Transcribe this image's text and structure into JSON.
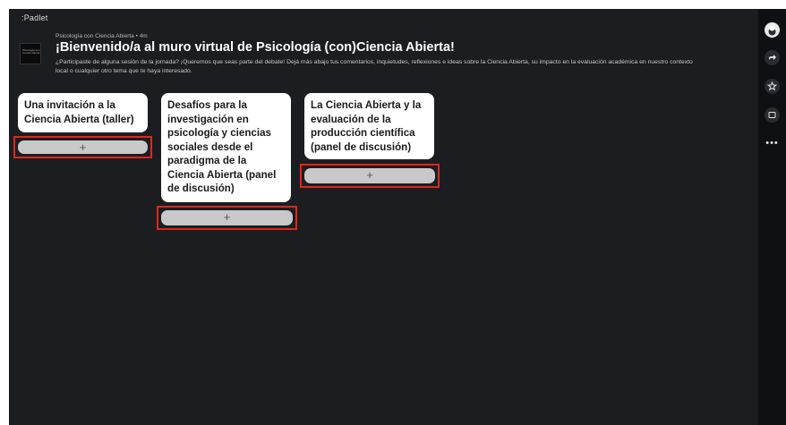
{
  "app": {
    "brand": ":Padlet"
  },
  "header": {
    "thumbnail_text": "Psicología con ciencia abierta",
    "author_line": "Psicología con Ciencia Abierta • 4m",
    "title": "¡Bienvenido/a al muro virtual de Psicología (con)Ciencia Abierta!",
    "description": "¿Participaste de alguna sesión de la jornada? ¡Queremos que seas parte del debate! Dejá más abajo tus comentarios, inquietudes, reflexiones e ideas sobre la Ciencia Abierta, su impacto en la evaluación académica en nuestro contexto local o cualquier otro tema que te haya interesado."
  },
  "columns": [
    {
      "title": "Una invitación a la Ciencia Abierta (taller)",
      "add_label": "+"
    },
    {
      "title": "Desafíos para la investigación en psicología y ciencias sociales desde el paradigma de la Ciencia Abierta (panel de discusión)",
      "add_label": "+"
    },
    {
      "title": "La Ciencia Abierta y la evaluación de la producción científica (panel de discusión)",
      "add_label": "+"
    }
  ],
  "rail": {
    "share_icon": "share-icon",
    "star_icon": "star-icon",
    "slideshow_icon": "slideshow-icon",
    "more_label": "•••"
  },
  "colors": {
    "background": "#1c1d21",
    "highlight": "#e0261b",
    "card": "#ffffff",
    "add_button": "#c8c8c8"
  }
}
